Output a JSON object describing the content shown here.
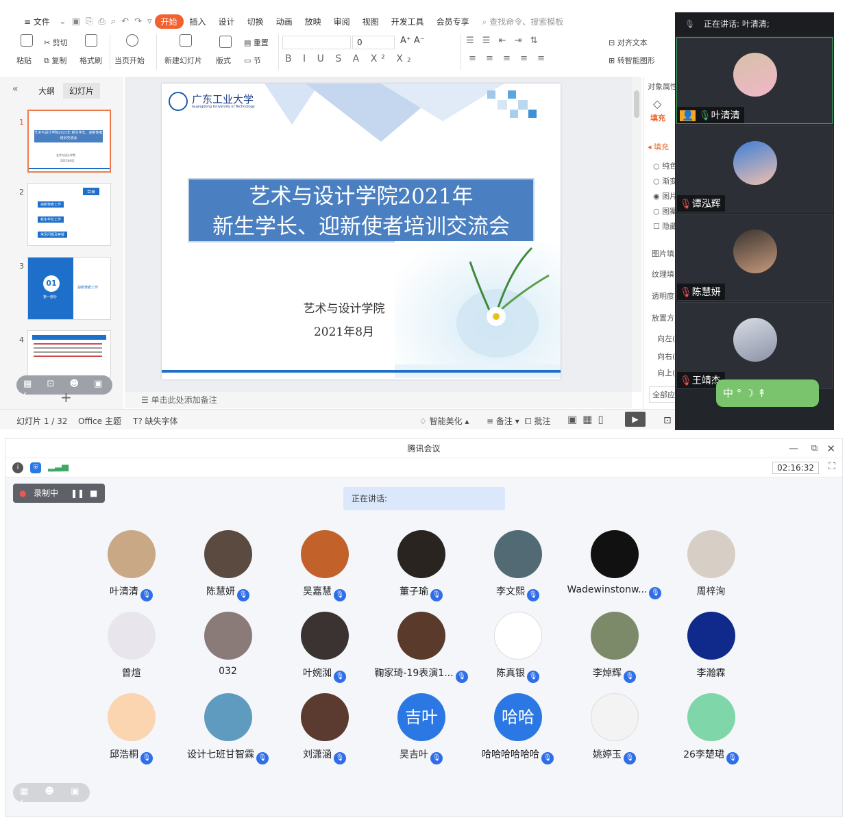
{
  "wps": {
    "menu": [
      "≡ 文件",
      "开始",
      "插入",
      "设计",
      "切换",
      "动画",
      "放映",
      "审阅",
      "视图",
      "开发工具",
      "会员专享"
    ],
    "active_menu": "开始",
    "search_placeholder": "查找命令、搜索模板",
    "ribbon": {
      "paste": "粘贴",
      "cut": "剪切",
      "copy": "复制",
      "format_painter": "格式刷",
      "from_start": "当页开始",
      "new_slide": "新建幻灯片",
      "layout": "版式",
      "reset": "重置",
      "section": "节",
      "font_size": "0",
      "align_text": "对齐文本",
      "smart_shape": "转智能图形"
    },
    "panel_tabs": {
      "outline": "大纲",
      "slides": "幻灯片"
    },
    "thumb_numbers": [
      "1",
      "2",
      "3",
      "4"
    ],
    "thumb1": {
      "title": "艺术与设计学院2021年 新生学长、迎新使者培训交流会",
      "sub1": "艺术与设计学院",
      "sub2": "2021年8月"
    },
    "thumb2": {
      "tag": "目录",
      "items": [
        "迎新使者工作",
        "新生学长工作",
        "常见问题及答疑"
      ]
    },
    "thumb3": {
      "num": "01",
      "part": "第一部分",
      "label": "迎新使者工作"
    },
    "slide": {
      "logo_cn": "广东工业大学",
      "logo_en": "Guangdong University of Technology",
      "title_line1": "艺术与设计学院2021年",
      "title_line2": "新生学长、迎新使者培训交流会",
      "org": "艺术与设计学院",
      "date": "2021年8月"
    },
    "props": {
      "header": "对象属性",
      "fill_tab": "填充",
      "fill_section": "填充",
      "options": [
        "纯色",
        "渐变",
        "图片",
        "图案",
        "隐藏"
      ],
      "image_fill": "图片填",
      "texture_fill": "纹理填",
      "transparency": "透明度",
      "placement": "放置方",
      "offsets": [
        "向左(",
        "向右(",
        "向上("
      ],
      "apply_all": "全部应"
    },
    "notes_placeholder": "单击此处添加备注",
    "status": {
      "slide_count": "幻灯片 1 / 32",
      "theme": "Office 主题",
      "missing_font": "缺失字体",
      "beautify": "智能美化",
      "notes": "备注",
      "comments": "批注"
    }
  },
  "video_strip": {
    "speaking_label": "正在讲话: 叶清清;",
    "tiles": [
      {
        "name": "叶清清",
        "active": true
      },
      {
        "name": "谭泓辉",
        "active": false
      },
      {
        "name": "陈慧妍",
        "active": false
      },
      {
        "name": "王靖杰",
        "active": false
      }
    ],
    "ime_label": "中 ° ☽ ↟"
  },
  "meeting": {
    "title": "腾讯会议",
    "timer": "02:16:32",
    "recording_label": "录制中",
    "speaking_label": "正在讲话:",
    "participants": [
      {
        "name": "叶清清",
        "mic": true,
        "avatar_color": "#c9a886"
      },
      {
        "name": "陈慧妍",
        "mic": true,
        "avatar_color": "#5a4a40"
      },
      {
        "name": "吴嘉慧",
        "mic": true,
        "avatar_color": "#c2622a"
      },
      {
        "name": "董子瑜",
        "mic": true,
        "avatar_color": "#2a2421"
      },
      {
        "name": "李文熙",
        "mic": true,
        "avatar_color": "#516a73"
      },
      {
        "name": "Wadewinstonw...",
        "mic": true,
        "avatar_color": "#111111"
      },
      {
        "name": "周梓洵",
        "mic": false,
        "avatar_color": "#d7cfc6"
      },
      {
        "name": "曾煊",
        "mic": false,
        "avatar_color": "#e8e6ec"
      },
      {
        "name": "032",
        "mic": false,
        "avatar_color": "#8a7a78"
      },
      {
        "name": "叶婉洳",
        "mic": true,
        "avatar_color": "#3b3331"
      },
      {
        "name": "鞠家琦-19表演1...",
        "mic": true,
        "avatar_color": "#5a3a2a"
      },
      {
        "name": "陈真银",
        "mic": true,
        "avatar_color": "#ffffff"
      },
      {
        "name": "李焯辉",
        "mic": true,
        "avatar_color": "#7d8a6a"
      },
      {
        "name": "李瀚霖",
        "mic": false,
        "avatar_color": "#0f2a8a"
      },
      {
        "name": "邱浩桐",
        "mic": true,
        "avatar_color": "#fbd4b0"
      },
      {
        "name": "设计七班甘智霖",
        "mic": true,
        "avatar_color": "#5f9bbf"
      },
      {
        "name": "刘潇涵",
        "mic": true,
        "avatar_color": "#5b3a2f"
      },
      {
        "name": "吴吉叶",
        "mic": true,
        "avatar_color": "#2b78e4",
        "initials": "吉叶"
      },
      {
        "name": "哈哈哈哈哈哈",
        "mic": true,
        "avatar_color": "#2b78e4",
        "initials": "哈哈"
      },
      {
        "name": "姚婷玉",
        "mic": true,
        "avatar_color": "#f3f3f3"
      },
      {
        "name": "26李楚珺",
        "mic": true,
        "avatar_color": "#7fd6a8"
      }
    ]
  },
  "colors": {
    "wps_accent": "#f2612f",
    "slide_blue": "#4a7fc1",
    "tencent_blue": "#2b78e4",
    "active_green": "#3fa864"
  }
}
